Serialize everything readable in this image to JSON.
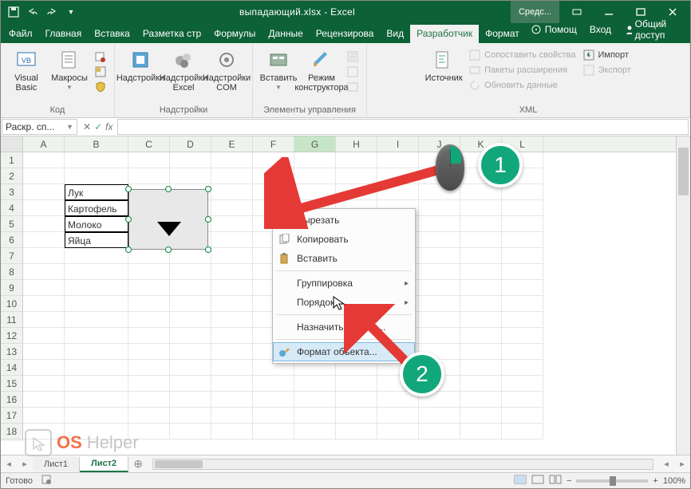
{
  "title": "выпадающий.xlsx - Excel",
  "tools_tab": "Средс...",
  "tabs": {
    "file": "Файл",
    "list": [
      "Главная",
      "Вставка",
      "Разметка стр",
      "Формулы",
      "Данные",
      "Рецензирова",
      "Вид",
      "Разработчик",
      "Формат"
    ]
  },
  "help": "Помощ",
  "signin": "Вход",
  "share": "Общий доступ",
  "ribbon": {
    "code": {
      "label": "Код",
      "vb": "Visual\nBasic",
      "macros": "Макросы"
    },
    "addins": {
      "label": "Надстройки",
      "a1": "Надстройки",
      "a2": "Надстройки\nExcel",
      "a3": "Надстройки\nCOM"
    },
    "controls": {
      "label": "Элементы управления",
      "insert": "Вставить",
      "design": "Режим\nконструктора"
    },
    "xml": {
      "label": "XML",
      "src": "Источник",
      "r1": "Сопоставить свойства",
      "r2": "Пакеты расширения",
      "r3": "Обновить данные",
      "r4": "Импорт",
      "r5": "Экспорт"
    }
  },
  "namebox": "Раскр. сп...",
  "fx": "fx",
  "columns": [
    "A",
    "B",
    "C",
    "D",
    "E",
    "F",
    "G",
    "H",
    "I",
    "J",
    "K",
    "L"
  ],
  "list_data": [
    "Лук",
    "Картофель",
    "Молоко",
    "Яйца"
  ],
  "row_count": 18,
  "ctx": {
    "cut": "Вырезать",
    "copy": "Копировать",
    "paste": "Вставить",
    "group": "Группировка",
    "order": "Порядок",
    "macro": "Назначить макрос...",
    "format": "Формат объекта..."
  },
  "sheets": {
    "s1": "Лист1",
    "s2": "Лист2"
  },
  "status": "Готово",
  "zoom": "100%",
  "badges": {
    "b1": "1",
    "b2": "2"
  },
  "watermark": {
    "a": "OS",
    "b": "Helper"
  }
}
